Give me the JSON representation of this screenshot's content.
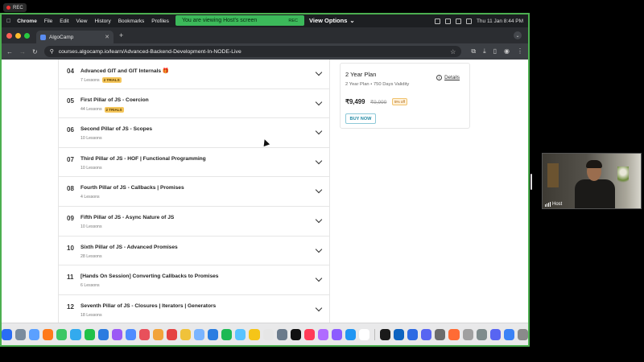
{
  "recording": {
    "label": "REC"
  },
  "menubar": {
    "app": "Chrome",
    "items": [
      "File",
      "Edit",
      "View",
      "History",
      "Bookmarks",
      "Profiles"
    ],
    "sharing_banner": "You are viewing  Host's screen",
    "sharing_rec": "REC",
    "view_options": "View Options",
    "datetime": "Thu 11 Jan  8:44 PM"
  },
  "browser": {
    "tab_title": "AlgoCamp",
    "url": "courses.algocamp.io/learn/Advanced-Backend-Development-In-NODE-Live"
  },
  "lessons": [
    {
      "num": "04",
      "title": "Advanced GIT and GIT Internals 🎁",
      "meta": "7 Lessons",
      "badge": "2 TRIALS"
    },
    {
      "num": "05",
      "title": "First Pillar of JS - Coercion",
      "meta": "44 Lessons",
      "badge": "2 TRIALS"
    },
    {
      "num": "06",
      "title": "Second Pillar of JS - Scopes",
      "meta": "10 Lessons",
      "badge": ""
    },
    {
      "num": "07",
      "title": "Third Pillar of JS - HOF | Functional Programming",
      "meta": "10 Lessons",
      "badge": ""
    },
    {
      "num": "08",
      "title": "Fourth Pillar of JS - Callbacks | Promises",
      "meta": "4 Lessons",
      "badge": ""
    },
    {
      "num": "09",
      "title": "Fifth Pillar of JS - Async Nature of JS",
      "meta": "10 Lessons",
      "badge": ""
    },
    {
      "num": "10",
      "title": "Sixth Pillar of JS - Advanced Promises",
      "meta": "28 Lessons",
      "badge": ""
    },
    {
      "num": "11",
      "title": "[Hands On Session] Converting Callbacks to Promises",
      "meta": "6 Lessons",
      "badge": ""
    },
    {
      "num": "12",
      "title": "Seventh Pillar of JS - Closures | Iterators | Generators",
      "meta": "18 Lessons",
      "badge": ""
    }
  ],
  "plan": {
    "title": "2 Year Plan",
    "subtitle": "2 Year Plan • 750 Days Validity",
    "details_label": "Details",
    "price": "₹9,499",
    "old_price": "₹9,999",
    "discount": "5% off",
    "buy_label": "BUY NOW"
  },
  "video": {
    "name": "Host"
  },
  "dock_colors": [
    "#2a6df4",
    "#7a8c9e",
    "#5ba0ff",
    "#ff7a1a",
    "#3cc765",
    "#33aaee",
    "#21c14a",
    "#2b7be0",
    "#9b59f5",
    "#4f8cff",
    "#e8505b",
    "#f2a33a",
    "#e54242",
    "#f0c23a",
    "#7ab4ff",
    "#2a7de1",
    "#1db954",
    "#59c3ff",
    "#f5c518",
    "#e6e6e6",
    "#6b7b8c",
    "#111111",
    "#ff3b57",
    "#b06bff",
    "#8c5cff",
    "#2196f3",
    "#ffffff",
    "#1a1a1a",
    "#0e63c0",
    "#2d6ae3",
    "#5865f2",
    "#6c6c6c",
    "#ff6b35",
    "#a0a0a0",
    "#7f8c8d",
    "#5865f2",
    "#3b82f6",
    "#8a8a8a"
  ]
}
